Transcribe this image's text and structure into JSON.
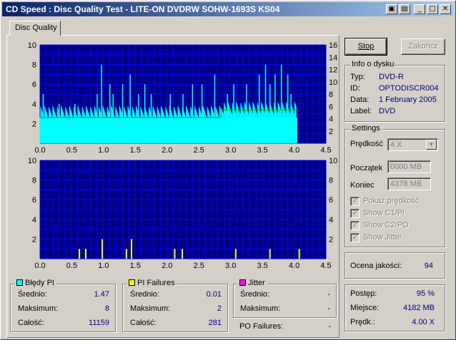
{
  "window": {
    "title": "CD Speed : Disc Quality Test - LITE-ON DVDRW SOHW-1693S KS04"
  },
  "tab": {
    "label": "Disc Quality"
  },
  "buttons": {
    "stop": "Stop",
    "finish": "Zakończ"
  },
  "disc_info": {
    "title": "Info o dysku",
    "rows": [
      {
        "label": "Typ:",
        "value": "DVD-R"
      },
      {
        "label": "ID:",
        "value": "OPTODISCR004"
      },
      {
        "label": "Data:",
        "value": "1 February 2005"
      },
      {
        "label": "Label:",
        "value": "DVD"
      }
    ]
  },
  "settings": {
    "title": "Settings",
    "speed_label": "Prędkość",
    "speed_value": "4 X",
    "start_label": "Początek",
    "start_value": "0000 MB",
    "end_label": "Koniec",
    "end_value": "4378 MB",
    "checkboxes": [
      {
        "label": "Pokaż prędkość",
        "checked": true
      },
      {
        "label": "Show C1/PI",
        "checked": true
      },
      {
        "label": "Show C2/PO",
        "checked": true
      },
      {
        "label": "Show Jitter",
        "checked": true
      }
    ]
  },
  "quality": {
    "label": "Ocena jakości:",
    "value": "94"
  },
  "progress": {
    "rows": [
      {
        "label": "Postęp:",
        "value": "95 %"
      },
      {
        "label": "Miejsce:",
        "value": "4182 MB"
      },
      {
        "label": "Prędk.:",
        "value": "4.00 X"
      }
    ]
  },
  "stats": {
    "pi_errors": {
      "title": "Błędy PI",
      "color": "#00ffff",
      "rows": [
        {
          "label": "Średnio:",
          "value": "1.47"
        },
        {
          "label": "Maksimum:",
          "value": "8"
        },
        {
          "label": "Całość:",
          "value": "11159"
        }
      ]
    },
    "pi_failures": {
      "title": "PI Failures",
      "color": "#ffff00",
      "rows": [
        {
          "label": "Średnio:",
          "value": "0.01"
        },
        {
          "label": "Maksimum:",
          "value": "2"
        },
        {
          "label": "Całość:",
          "value": "281"
        }
      ]
    },
    "jitter": {
      "title": "Jitter",
      "color": "#ff00ff",
      "rows": [
        {
          "label": "Średnio:",
          "value": "-"
        },
        {
          "label": "Maksimum:",
          "value": "-"
        }
      ]
    },
    "po_failures": {
      "label": "PO Failures:",
      "value": "-"
    }
  },
  "colors": {
    "plot_bg": "#000080",
    "grid": "#0000ff",
    "pi_fill": "#00ffff",
    "speed_line": "#00c000",
    "failures": "#ffff00",
    "axis_text": "#ffffff"
  },
  "chart_data": [
    {
      "type": "area",
      "title": "",
      "xlabel": "",
      "ylabel": "",
      "xlim": [
        0,
        4.5
      ],
      "ylim": [
        0,
        10
      ],
      "y2lim": [
        0,
        16
      ],
      "x_ticks": [
        "0.0",
        "0.5",
        "1.0",
        "1.5",
        "2.0",
        "2.5",
        "3.0",
        "3.5",
        "4.0",
        "4.5"
      ],
      "y_ticks": [
        "2",
        "4",
        "6",
        "8",
        "10"
      ],
      "y2_ticks": [
        "2",
        "4",
        "6",
        "8",
        "10",
        "12",
        "14",
        "16"
      ],
      "grid": true,
      "series": [
        {
          "kind": "area",
          "x": [
            0,
            0.1,
            0.2,
            0.3,
            0.4,
            0.5,
            0.6,
            0.7,
            0.8,
            0.9,
            1.0,
            1.1,
            1.2,
            1.3,
            1.4,
            1.5,
            1.6,
            1.7,
            1.8,
            1.9,
            2.0,
            2.1,
            2.2,
            2.3,
            2.4,
            2.5,
            2.6,
            2.7,
            2.8,
            2.9,
            3.0,
            3.1,
            3.2,
            3.3,
            3.4,
            3.5,
            3.6,
            3.7,
            3.8,
            3.9,
            4.0,
            4.05
          ],
          "y": [
            2.4,
            2.5,
            2.3,
            2.6,
            2.4,
            2.3,
            2.5,
            2.4,
            2.3,
            2.6,
            2.6,
            2.4,
            2.5,
            2.3,
            2.4,
            2.5,
            2.4,
            2.3,
            2.4,
            2.5,
            2.4,
            2.3,
            2.4,
            2.6,
            2.5,
            2.4,
            2.3,
            2.4,
            2.4,
            2.4,
            2.5,
            2.6,
            2.6,
            2.7,
            2.6,
            2.7,
            2.6,
            2.7,
            2.6,
            2.7,
            2.6,
            2.6
          ]
        },
        {
          "kind": "spikes",
          "x": [
            0.05,
            0.3,
            0.55,
            0.9,
            0.97,
            1.1,
            1.15,
            1.3,
            1.42,
            1.55,
            1.65,
            1.75,
            2.05,
            2.25,
            2.4,
            2.55,
            2.75,
            2.95,
            3.05,
            3.25,
            3.45,
            3.55,
            3.62,
            3.7,
            3.8,
            3.9,
            3.95
          ],
          "y": [
            5,
            4,
            4,
            5,
            8,
            6,
            5,
            6,
            7,
            5,
            6,
            5,
            5,
            5,
            6,
            6,
            7,
            5,
            6,
            6,
            7,
            8,
            6,
            7,
            8,
            7,
            5
          ]
        },
        {
          "kind": "line",
          "axis": "y2",
          "x": [
            0,
            2.85,
            2.86,
            4.05
          ],
          "y": [
            4.2,
            4.2,
            5.4,
            5.4
          ]
        }
      ]
    },
    {
      "type": "bar",
      "title": "",
      "xlabel": "",
      "ylabel": "",
      "xlim": [
        0,
        4.5
      ],
      "ylim": [
        0,
        10
      ],
      "x_ticks": [
        "0.0",
        "0.5",
        "1.0",
        "1.5",
        "2.0",
        "2.5",
        "3.0",
        "3.5",
        "4.0",
        "4.5"
      ],
      "y_ticks": [
        "2",
        "4",
        "6",
        "8",
        "10"
      ],
      "y2_ticks": [
        "2",
        "4",
        "6",
        "8",
        "10"
      ],
      "grid": true,
      "series": [
        {
          "kind": "spikes",
          "x": [
            0.62,
            0.72,
            0.98,
            1.36,
            1.44,
            2.12,
            2.24,
            3.08,
            3.62,
            4.08
          ],
          "y": [
            1,
            1,
            2,
            1,
            2,
            1,
            1,
            1,
            1,
            1
          ]
        }
      ]
    }
  ]
}
